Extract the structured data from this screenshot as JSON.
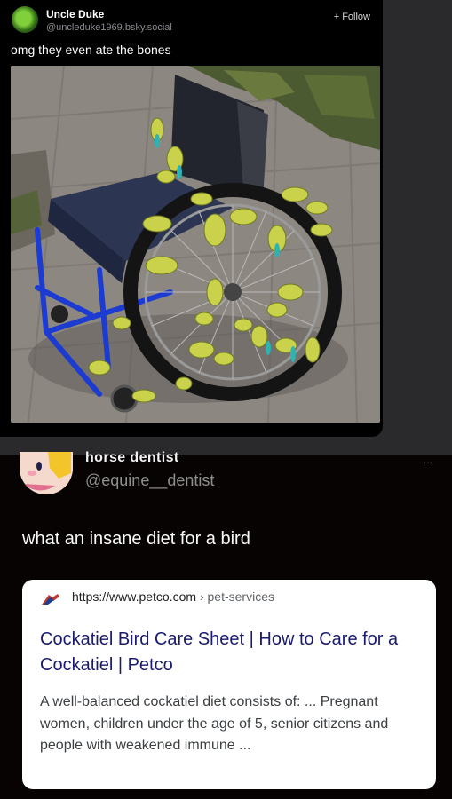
{
  "post1": {
    "author_name": "Uncle Duke",
    "author_handle": "@uncleduke1969.bsky.social",
    "follow_label": "+ Follow",
    "text": "omg they even ate the bones"
  },
  "post2": {
    "author_name": "horse dentist",
    "author_handle": "@equine__dentist",
    "more_label": "...",
    "text": "what an insane diet for a bird",
    "link_card": {
      "url_domain": "https://www.petco.com",
      "url_separator": "›",
      "url_path": "pet-services",
      "title": "Cockatiel Bird Care Sheet | How to Care for a Cockatiel | Petco",
      "snippet": "A well-balanced cockatiel diet consists of: ... Pregnant women, children under the age of 5, senior citizens and people with weakened immune ..."
    }
  },
  "colors": {
    "page_bg": "#2a2a2c",
    "post_bg": "#000000",
    "link_title": "#1a1a6e",
    "handle_gray": "#8e8e8e"
  }
}
